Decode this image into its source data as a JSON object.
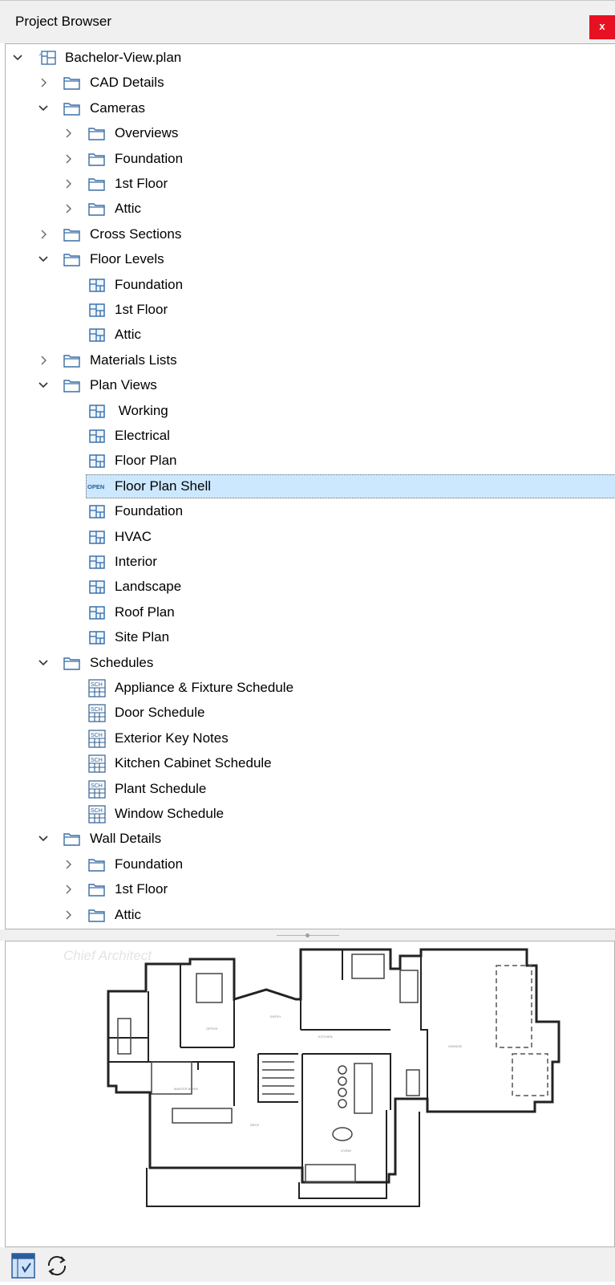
{
  "panel": {
    "title": "Project Browser",
    "close_label": "x"
  },
  "tree": [
    {
      "label": "Bachelor-View.plan",
      "level": 0,
      "expander": "open",
      "icon": "plan-file-icon"
    },
    {
      "label": "CAD Details",
      "level": 1,
      "expander": "closed",
      "icon": "folder-icon"
    },
    {
      "label": "Cameras",
      "level": 1,
      "expander": "open",
      "icon": "folder-icon"
    },
    {
      "label": "Overviews",
      "level": 2,
      "expander": "closed",
      "icon": "folder-icon"
    },
    {
      "label": "Foundation",
      "level": 2,
      "expander": "closed",
      "icon": "folder-icon"
    },
    {
      "label": "1st Floor",
      "level": 2,
      "expander": "closed",
      "icon": "folder-icon"
    },
    {
      "label": "Attic",
      "level": 2,
      "expander": "closed",
      "icon": "folder-icon"
    },
    {
      "label": "Cross Sections",
      "level": 1,
      "expander": "closed",
      "icon": "folder-icon"
    },
    {
      "label": "Floor Levels",
      "level": 1,
      "expander": "open",
      "icon": "folder-icon"
    },
    {
      "label": "Foundation",
      "level": 2,
      "expander": "none",
      "icon": "plan-view-icon"
    },
    {
      "label": "1st Floor",
      "level": 2,
      "expander": "none",
      "icon": "plan-view-icon"
    },
    {
      "label": "Attic",
      "level": 2,
      "expander": "none",
      "icon": "plan-view-icon"
    },
    {
      "label": "Materials Lists",
      "level": 1,
      "expander": "closed",
      "icon": "folder-icon"
    },
    {
      "label": "Plan Views",
      "level": 1,
      "expander": "open",
      "icon": "folder-icon"
    },
    {
      "label": " Working",
      "level": 2,
      "expander": "none",
      "icon": "plan-view-icon"
    },
    {
      "label": "Electrical",
      "level": 2,
      "expander": "none",
      "icon": "plan-view-icon"
    },
    {
      "label": "Floor Plan",
      "level": 2,
      "expander": "none",
      "icon": "plan-view-icon"
    },
    {
      "label": "Floor Plan Shell",
      "level": 2,
      "expander": "none",
      "icon": "open-badge-icon",
      "badge": "OPEN",
      "selected": true
    },
    {
      "label": "Foundation",
      "level": 2,
      "expander": "none",
      "icon": "plan-view-icon"
    },
    {
      "label": "HVAC",
      "level": 2,
      "expander": "none",
      "icon": "plan-view-icon"
    },
    {
      "label": "Interior",
      "level": 2,
      "expander": "none",
      "icon": "plan-view-icon"
    },
    {
      "label": "Landscape",
      "level": 2,
      "expander": "none",
      "icon": "plan-view-icon"
    },
    {
      "label": "Roof Plan",
      "level": 2,
      "expander": "none",
      "icon": "plan-view-icon"
    },
    {
      "label": "Site Plan",
      "level": 2,
      "expander": "none",
      "icon": "plan-view-icon"
    },
    {
      "label": "Schedules",
      "level": 1,
      "expander": "open",
      "icon": "folder-icon"
    },
    {
      "label": "Appliance & Fixture Schedule",
      "level": 2,
      "expander": "none",
      "icon": "schedule-icon",
      "badge": "SCH"
    },
    {
      "label": "Door Schedule",
      "level": 2,
      "expander": "none",
      "icon": "schedule-icon",
      "badge": "SCH"
    },
    {
      "label": "Exterior Key Notes",
      "level": 2,
      "expander": "none",
      "icon": "schedule-icon",
      "badge": "SCH"
    },
    {
      "label": "Kitchen Cabinet Schedule",
      "level": 2,
      "expander": "none",
      "icon": "schedule-icon",
      "badge": "SCH"
    },
    {
      "label": "Plant Schedule",
      "level": 2,
      "expander": "none",
      "icon": "schedule-icon",
      "badge": "SCH"
    },
    {
      "label": "Window Schedule",
      "level": 2,
      "expander": "none",
      "icon": "schedule-icon",
      "badge": "SCH"
    },
    {
      "label": "Wall Details",
      "level": 1,
      "expander": "open",
      "icon": "folder-icon"
    },
    {
      "label": "Foundation",
      "level": 2,
      "expander": "closed",
      "icon": "folder-icon"
    },
    {
      "label": "1st Floor",
      "level": 2,
      "expander": "closed",
      "icon": "folder-icon"
    },
    {
      "label": "Attic",
      "level": 2,
      "expander": "closed",
      "icon": "folder-icon"
    }
  ],
  "preview": {
    "watermark": "Chief Architect"
  },
  "toolbar": {
    "buttons": [
      "auto-preview-toggle-icon",
      "refresh-icon"
    ]
  }
}
